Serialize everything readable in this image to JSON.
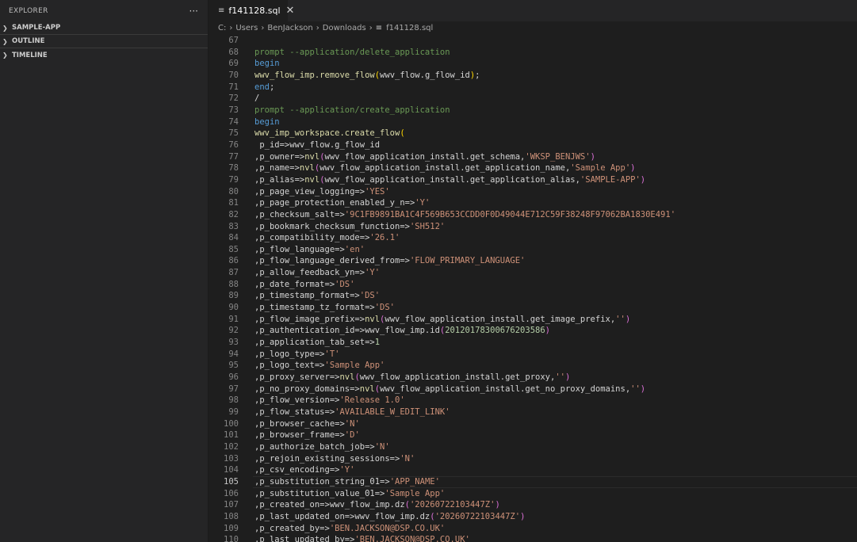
{
  "sidebar": {
    "title": "EXPLORER",
    "more": "···",
    "sections": [
      {
        "label": "SAMPLE-APP"
      },
      {
        "label": "OUTLINE"
      },
      {
        "label": "TIMELINE"
      }
    ]
  },
  "tab": {
    "label": "f141128.sql",
    "close": "✕"
  },
  "breadcrumb": [
    "C:",
    "Users",
    "BenJackson",
    "Downloads",
    "f141128.sql"
  ],
  "editor": {
    "current_line": 105,
    "lines": [
      {
        "n": 67,
        "t": []
      },
      {
        "n": 68,
        "t": [
          [
            "cm",
            "prompt --application/delete_application"
          ]
        ]
      },
      {
        "n": 69,
        "t": [
          [
            "kw",
            "begin"
          ]
        ]
      },
      {
        "n": 70,
        "t": [
          [
            "fn",
            "wwv_flow_imp.remove_flow"
          ],
          [
            "p1",
            "("
          ],
          [
            "id",
            "wwv_flow.g_flow_id"
          ],
          [
            "p1",
            ")"
          ],
          [
            "id",
            ";"
          ]
        ]
      },
      {
        "n": 71,
        "t": [
          [
            "kw",
            "end"
          ],
          [
            "id",
            ";"
          ]
        ]
      },
      {
        "n": 72,
        "t": [
          [
            "id",
            "/"
          ]
        ]
      },
      {
        "n": 73,
        "t": [
          [
            "cm",
            "prompt --application/create_application"
          ]
        ]
      },
      {
        "n": 74,
        "t": [
          [
            "kw",
            "begin"
          ]
        ]
      },
      {
        "n": 75,
        "t": [
          [
            "fn",
            "wwv_imp_workspace.create_flow"
          ],
          [
            "p1",
            "("
          ]
        ]
      },
      {
        "n": 76,
        "t": [
          [
            "id",
            " p_id=>wwv_flow.g_flow_id"
          ]
        ]
      },
      {
        "n": 77,
        "t": [
          [
            "id",
            ",p_owner=>"
          ],
          [
            "fn",
            "nvl"
          ],
          [
            "p2",
            "("
          ],
          [
            "id",
            "wwv_flow_application_install.get_schema,"
          ],
          [
            "str",
            "'WKSP_BENJWS'"
          ],
          [
            "p2",
            ")"
          ]
        ]
      },
      {
        "n": 78,
        "t": [
          [
            "id",
            ",p_name=>"
          ],
          [
            "fn",
            "nvl"
          ],
          [
            "p2",
            "("
          ],
          [
            "id",
            "wwv_flow_application_install.get_application_name,"
          ],
          [
            "str",
            "'Sample App'"
          ],
          [
            "p2",
            ")"
          ]
        ]
      },
      {
        "n": 79,
        "t": [
          [
            "id",
            ",p_alias=>"
          ],
          [
            "fn",
            "nvl"
          ],
          [
            "p2",
            "("
          ],
          [
            "id",
            "wwv_flow_application_install.get_application_alias,"
          ],
          [
            "str",
            "'SAMPLE-APP'"
          ],
          [
            "p2",
            ")"
          ]
        ]
      },
      {
        "n": 80,
        "t": [
          [
            "id",
            ",p_page_view_logging=>"
          ],
          [
            "str",
            "'YES'"
          ]
        ]
      },
      {
        "n": 81,
        "t": [
          [
            "id",
            ",p_page_protection_enabled_y_n=>"
          ],
          [
            "str",
            "'Y'"
          ]
        ]
      },
      {
        "n": 82,
        "t": [
          [
            "id",
            ",p_checksum_salt=>"
          ],
          [
            "str",
            "'9C1FB9891BA1C4F569B653CCDD0F0D49044E712C59F38248F97062BA1830E491'"
          ]
        ]
      },
      {
        "n": 83,
        "t": [
          [
            "id",
            ",p_bookmark_checksum_function=>"
          ],
          [
            "str",
            "'SH512'"
          ]
        ]
      },
      {
        "n": 84,
        "t": [
          [
            "id",
            ",p_compatibility_mode=>"
          ],
          [
            "str",
            "'26.1'"
          ]
        ]
      },
      {
        "n": 85,
        "t": [
          [
            "id",
            ",p_flow_language=>"
          ],
          [
            "str",
            "'en'"
          ]
        ]
      },
      {
        "n": 86,
        "t": [
          [
            "id",
            ",p_flow_language_derived_from=>"
          ],
          [
            "str",
            "'FLOW_PRIMARY_LANGUAGE'"
          ]
        ]
      },
      {
        "n": 87,
        "t": [
          [
            "id",
            ",p_allow_feedback_yn=>"
          ],
          [
            "str",
            "'Y'"
          ]
        ]
      },
      {
        "n": 88,
        "t": [
          [
            "id",
            ",p_date_format=>"
          ],
          [
            "str",
            "'DS'"
          ]
        ]
      },
      {
        "n": 89,
        "t": [
          [
            "id",
            ",p_timestamp_format=>"
          ],
          [
            "str",
            "'DS'"
          ]
        ]
      },
      {
        "n": 90,
        "t": [
          [
            "id",
            ",p_timestamp_tz_format=>"
          ],
          [
            "str",
            "'DS'"
          ]
        ]
      },
      {
        "n": 91,
        "t": [
          [
            "id",
            ",p_flow_image_prefix=>"
          ],
          [
            "fn",
            "nvl"
          ],
          [
            "p2",
            "("
          ],
          [
            "id",
            "wwv_flow_application_install.get_image_prefix,"
          ],
          [
            "str",
            "''"
          ],
          [
            "p2",
            ")"
          ]
        ]
      },
      {
        "n": 92,
        "t": [
          [
            "id",
            ",p_authentication_id=>wwv_flow_imp.id"
          ],
          [
            "p2",
            "("
          ],
          [
            "num",
            "20120178300676203586"
          ],
          [
            "p2",
            ")"
          ]
        ]
      },
      {
        "n": 93,
        "t": [
          [
            "id",
            ",p_application_tab_set=>"
          ],
          [
            "num",
            "1"
          ]
        ]
      },
      {
        "n": 94,
        "t": [
          [
            "id",
            ",p_logo_type=>"
          ],
          [
            "str",
            "'T'"
          ]
        ]
      },
      {
        "n": 95,
        "t": [
          [
            "id",
            ",p_logo_text=>"
          ],
          [
            "str",
            "'Sample App'"
          ]
        ]
      },
      {
        "n": 96,
        "t": [
          [
            "id",
            ",p_proxy_server=>"
          ],
          [
            "fn",
            "nvl"
          ],
          [
            "p2",
            "("
          ],
          [
            "id",
            "wwv_flow_application_install.get_proxy,"
          ],
          [
            "str",
            "''"
          ],
          [
            "p2",
            ")"
          ]
        ]
      },
      {
        "n": 97,
        "t": [
          [
            "id",
            ",p_no_proxy_domains=>"
          ],
          [
            "fn",
            "nvl"
          ],
          [
            "p2",
            "("
          ],
          [
            "id",
            "wwv_flow_application_install.get_no_proxy_domains,"
          ],
          [
            "str",
            "''"
          ],
          [
            "p2",
            ")"
          ]
        ]
      },
      {
        "n": 98,
        "t": [
          [
            "id",
            ",p_flow_version=>"
          ],
          [
            "str",
            "'Release 1.0'"
          ]
        ]
      },
      {
        "n": 99,
        "t": [
          [
            "id",
            ",p_flow_status=>"
          ],
          [
            "str",
            "'AVAILABLE_W_EDIT_LINK'"
          ]
        ]
      },
      {
        "n": 100,
        "t": [
          [
            "id",
            ",p_browser_cache=>"
          ],
          [
            "str",
            "'N'"
          ]
        ]
      },
      {
        "n": 101,
        "t": [
          [
            "id",
            ",p_browser_frame=>"
          ],
          [
            "str",
            "'D'"
          ]
        ]
      },
      {
        "n": 102,
        "t": [
          [
            "id",
            ",p_authorize_batch_job=>"
          ],
          [
            "str",
            "'N'"
          ]
        ]
      },
      {
        "n": 103,
        "t": [
          [
            "id",
            ",p_rejoin_existing_sessions=>"
          ],
          [
            "str",
            "'N'"
          ]
        ]
      },
      {
        "n": 104,
        "t": [
          [
            "id",
            ",p_csv_encoding=>"
          ],
          [
            "str",
            "'Y'"
          ]
        ]
      },
      {
        "n": 105,
        "t": [
          [
            "id",
            ",p_substitution_string_01=>"
          ],
          [
            "str",
            "'APP_NAME'"
          ]
        ]
      },
      {
        "n": 106,
        "t": [
          [
            "id",
            ",p_substitution_value_01=>"
          ],
          [
            "str",
            "'Sample App'"
          ]
        ]
      },
      {
        "n": 107,
        "t": [
          [
            "id",
            ",p_created_on=>wwv_flow_imp.dz"
          ],
          [
            "p2",
            "("
          ],
          [
            "str",
            "'20260722103447Z'"
          ],
          [
            "p2",
            ")"
          ]
        ]
      },
      {
        "n": 108,
        "t": [
          [
            "id",
            ",p_last_updated_on=>wwv_flow_imp.dz"
          ],
          [
            "p2",
            "("
          ],
          [
            "str",
            "'20260722103447Z'"
          ],
          [
            "p2",
            ")"
          ]
        ]
      },
      {
        "n": 109,
        "t": [
          [
            "id",
            ",p_created_by=>"
          ],
          [
            "str",
            "'BEN.JACKSON@DSP.CO.UK'"
          ]
        ]
      },
      {
        "n": 110,
        "t": [
          [
            "id",
            ",p_last_updated_by=>"
          ],
          [
            "str",
            "'BEN.JACKSON@DSP.CO.UK'"
          ]
        ]
      }
    ]
  }
}
